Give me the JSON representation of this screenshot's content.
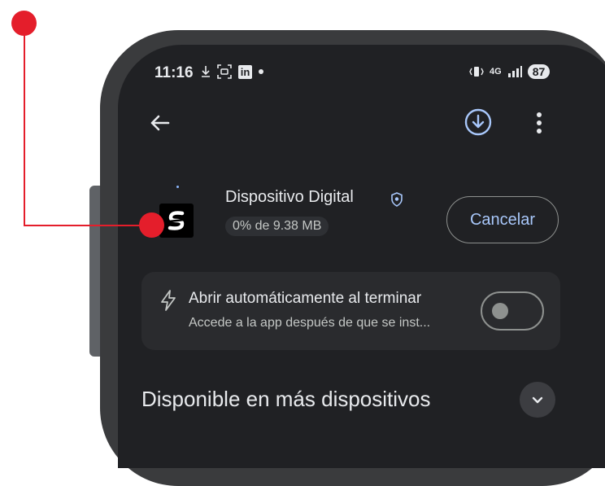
{
  "status_bar": {
    "time": "11:16",
    "network": "4G",
    "battery": "87"
  },
  "toolbar": {
    "back_icon": "arrow-left-icon",
    "download_icon": "download-circle-icon",
    "more_icon": "more-vert-icon"
  },
  "app": {
    "name": "Dispositivo Digital",
    "progress_text": "0% de 9.38 MB",
    "download_progress": 0,
    "cancel_label": "Cancelar"
  },
  "auto_open": {
    "title": "Abrir automáticamente al terminar",
    "subtitle": "Accede a la app después de que se inst...",
    "enabled": false
  },
  "section": {
    "title": "Disponible en más dispositivos"
  },
  "colors": {
    "accent": "#a8c7fa",
    "background": "#202124",
    "callout": "#e41e2b"
  }
}
